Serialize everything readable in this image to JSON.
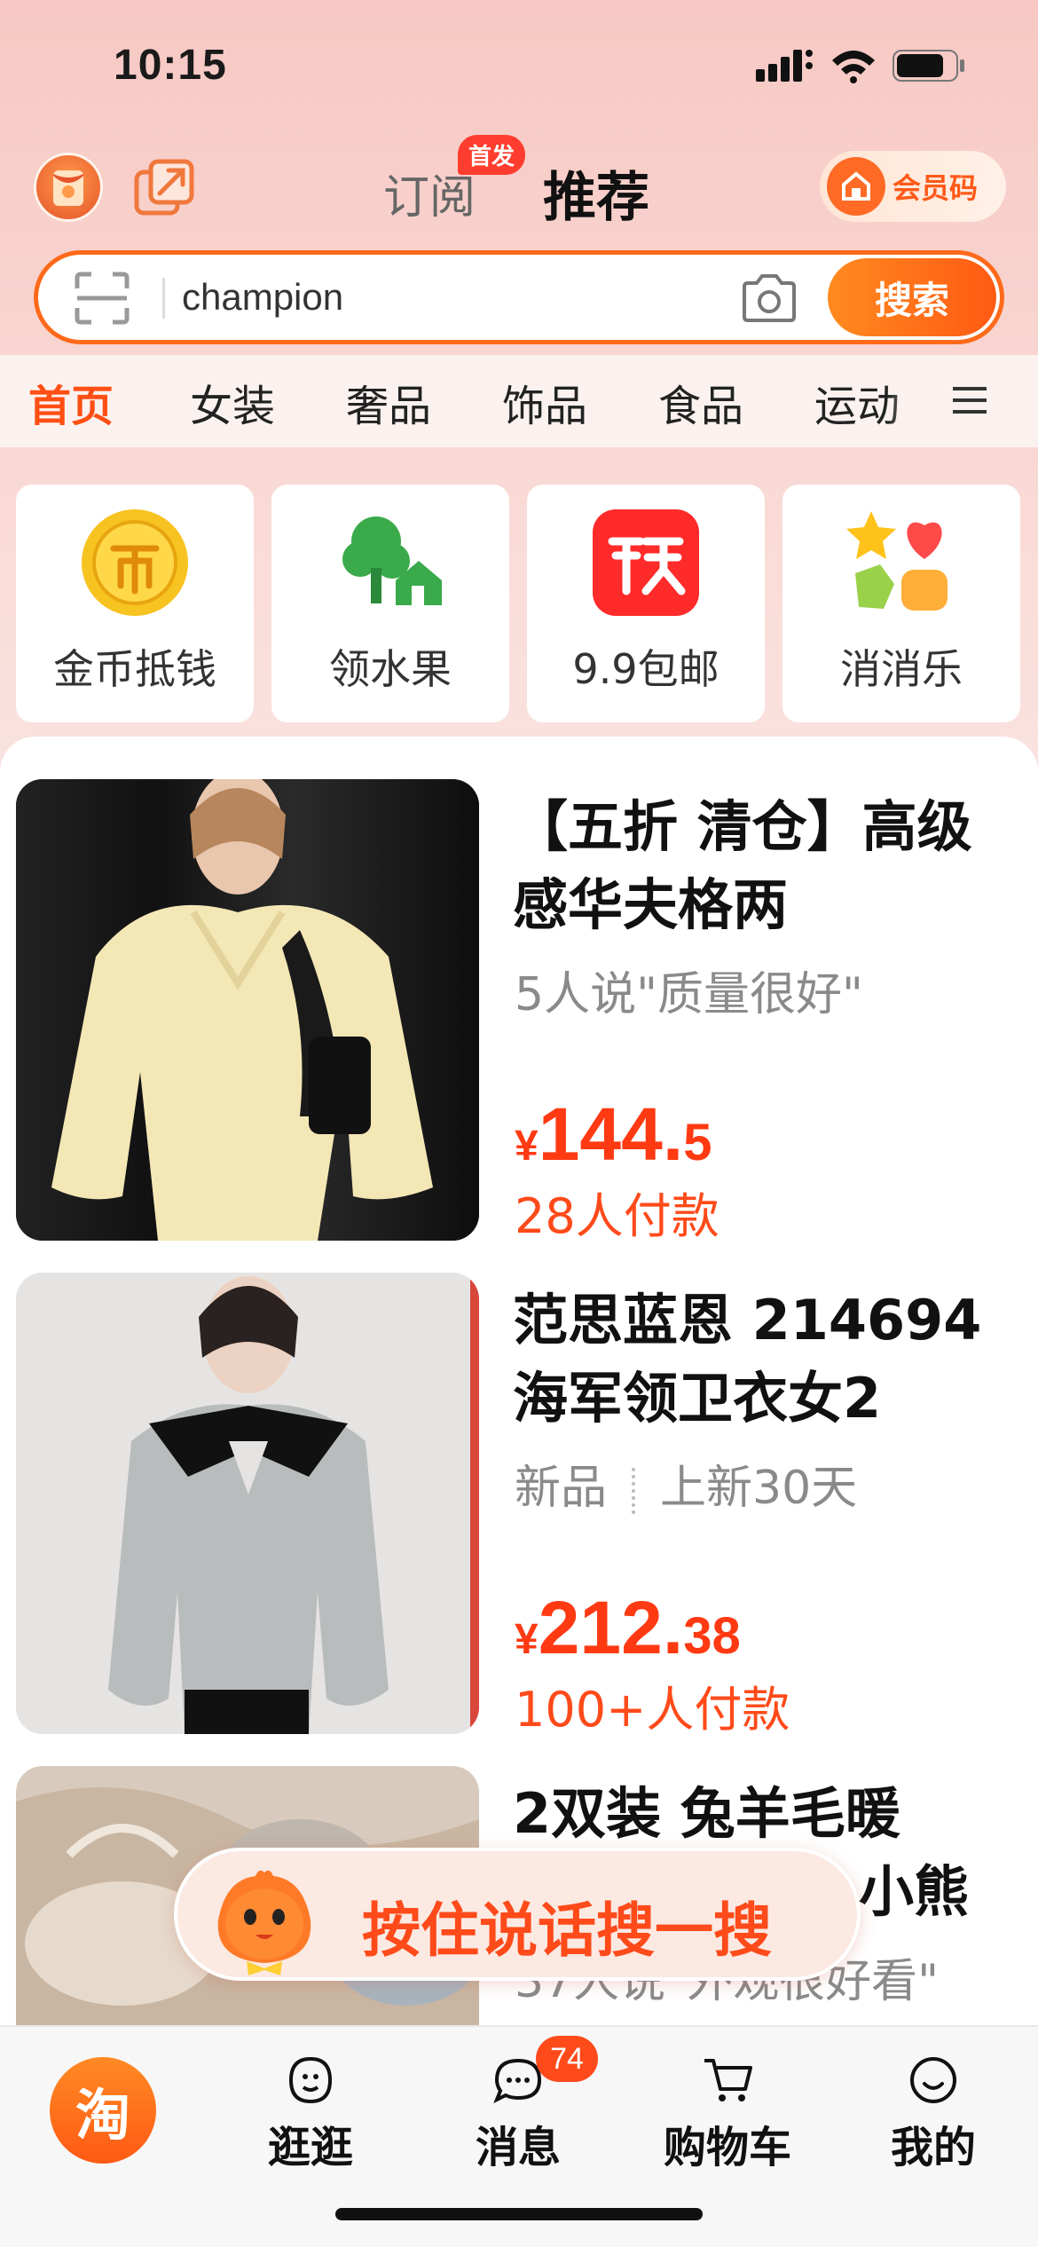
{
  "status_bar": {
    "time": "10:15"
  },
  "header": {
    "tab_subscribe": "订阅",
    "first_badge": "首发",
    "tab_recommend": "推荐",
    "member_code": "会员码"
  },
  "search": {
    "value": "champion",
    "button": "搜索"
  },
  "categories": [
    "首页",
    "女装",
    "奢品",
    "饰品",
    "食品",
    "运动"
  ],
  "quick_links": [
    {
      "label": "金币抵钱",
      "icon": "gold-coin-icon"
    },
    {
      "label": "领水果",
      "icon": "tree-house-icon"
    },
    {
      "label": "9.9包邮",
      "icon": "flash-sale-icon"
    },
    {
      "label": "消消乐",
      "icon": "match-game-icon"
    }
  ],
  "products": [
    {
      "title": "【五折 清仓】高级感华夫格两",
      "meta": "5人说\"质量很好\"",
      "price_currency": "¥",
      "price_int": "144.",
      "price_dec": "5",
      "sold": "28人付款"
    },
    {
      "title": "范思蓝恩 214694海军领卫衣女2",
      "meta_a": "新品",
      "meta_b": "上新30天",
      "price_currency": "¥",
      "price_int": "212.",
      "price_dec": "38",
      "sold": "100+人付款"
    },
    {
      "title": "2双装 兔羊毛暖",
      "title_tail": "小熊",
      "meta": "37人说\"外观很好看\""
    }
  ],
  "voice_search": "按住说话搜一搜",
  "tabbar": {
    "home": "淘",
    "browse": "逛逛",
    "messages": "消息",
    "messages_badge": "74",
    "cart": "购物车",
    "me": "我的"
  },
  "colors": {
    "accent": "#ff5a13",
    "price": "#ff3a13"
  }
}
